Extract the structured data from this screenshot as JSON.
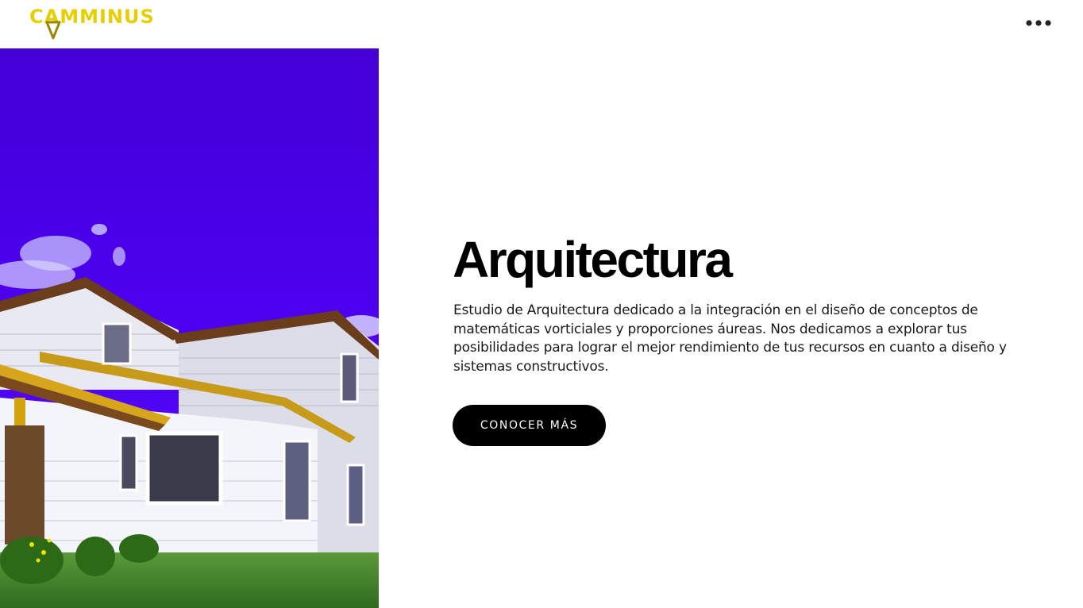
{
  "header": {
    "logo_text": "CAMMINUS",
    "menu_icon": "more-horizontal-icon"
  },
  "hero": {
    "image_description_icon": "house-photo",
    "title": "Arquitectura",
    "description": "Estudio de Arquitectura dedicado a la integración en el diseño de conceptos de matemáticas vorticiales y proporciones áureas. Nos dedicamos a explorar tus posibilidades para lograr el mejor rendimiento de tus recursos en cuanto a diseño y sistemas constructivos.",
    "cta_label": "CONOCER MÁS"
  },
  "colors": {
    "brand_yellow": "#e6cf00",
    "sky": "#4a00e6",
    "button": "#000000",
    "background": "#ffffff"
  }
}
